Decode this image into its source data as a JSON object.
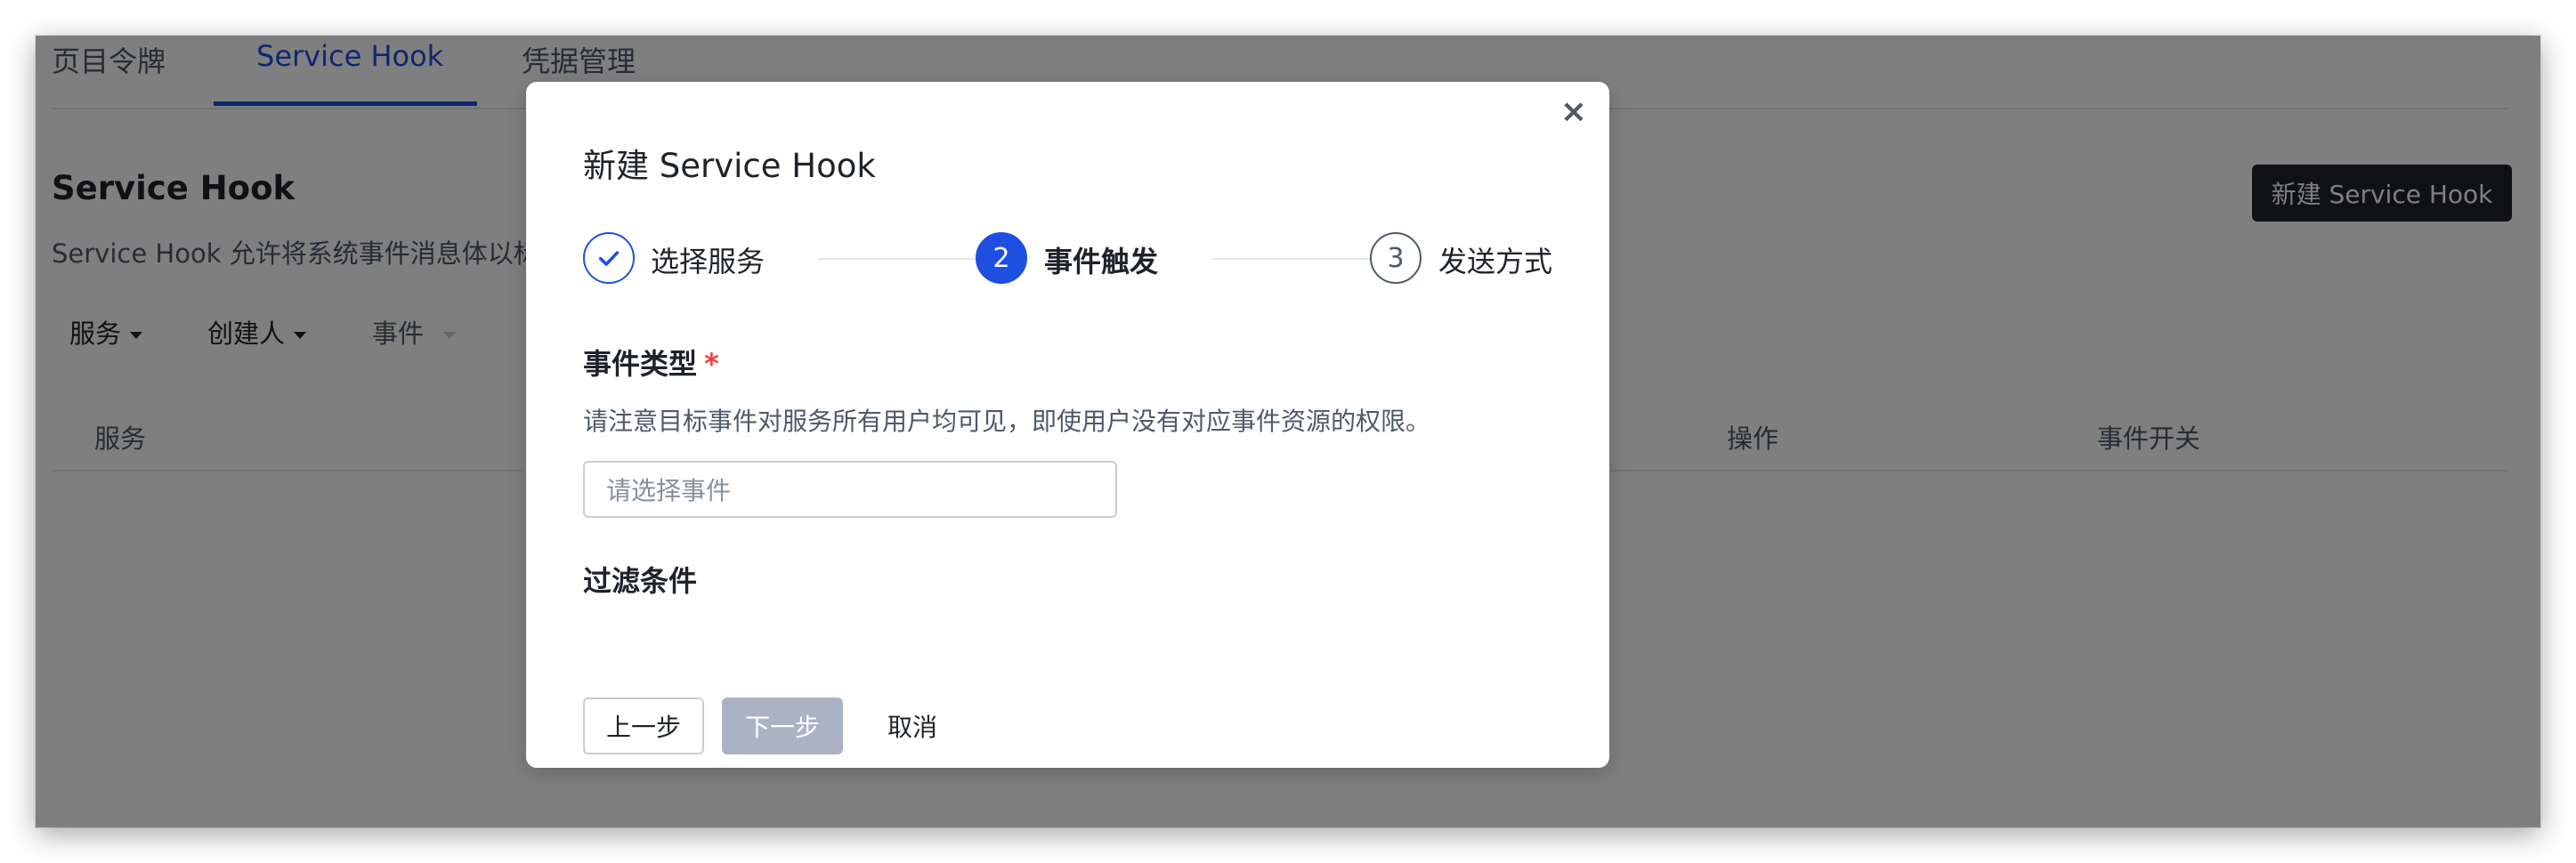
{
  "tabs": [
    {
      "label": "页目令牌"
    },
    {
      "label": "Service Hook"
    },
    {
      "label": "凭据管理"
    }
  ],
  "page": {
    "title": "Service Hook",
    "description": "Service Hook 允许将系统事件消息体以标准",
    "new_button": "新建 Service Hook"
  },
  "filters": [
    {
      "label": "服务"
    },
    {
      "label": "创建人"
    },
    {
      "label": "事件"
    }
  ],
  "table": {
    "columns": [
      "服务",
      "操作",
      "事件开关"
    ]
  },
  "modal": {
    "title": "新建 Service Hook",
    "close_symbol": "×",
    "steps": [
      {
        "number": "1",
        "label": "选择服务",
        "status": "done"
      },
      {
        "number": "2",
        "label": "事件触发",
        "status": "current"
      },
      {
        "number": "3",
        "label": "发送方式",
        "status": "pending"
      }
    ],
    "event_type": {
      "label": "事件类型",
      "required_mark": "*",
      "hint": "请注意目标事件对服务所有用户均可见，即使用户没有对应事件资源的权限。",
      "placeholder": "请选择事件"
    },
    "filter_conditions": {
      "label": "过滤条件"
    },
    "buttons": {
      "prev": "上一步",
      "next": "下一步",
      "cancel": "取消"
    }
  },
  "colors": {
    "primary": "#1f4fe0",
    "dark_button": "#1f2329",
    "disabled_button": "#aab3c3",
    "required": "#f53f3f"
  }
}
